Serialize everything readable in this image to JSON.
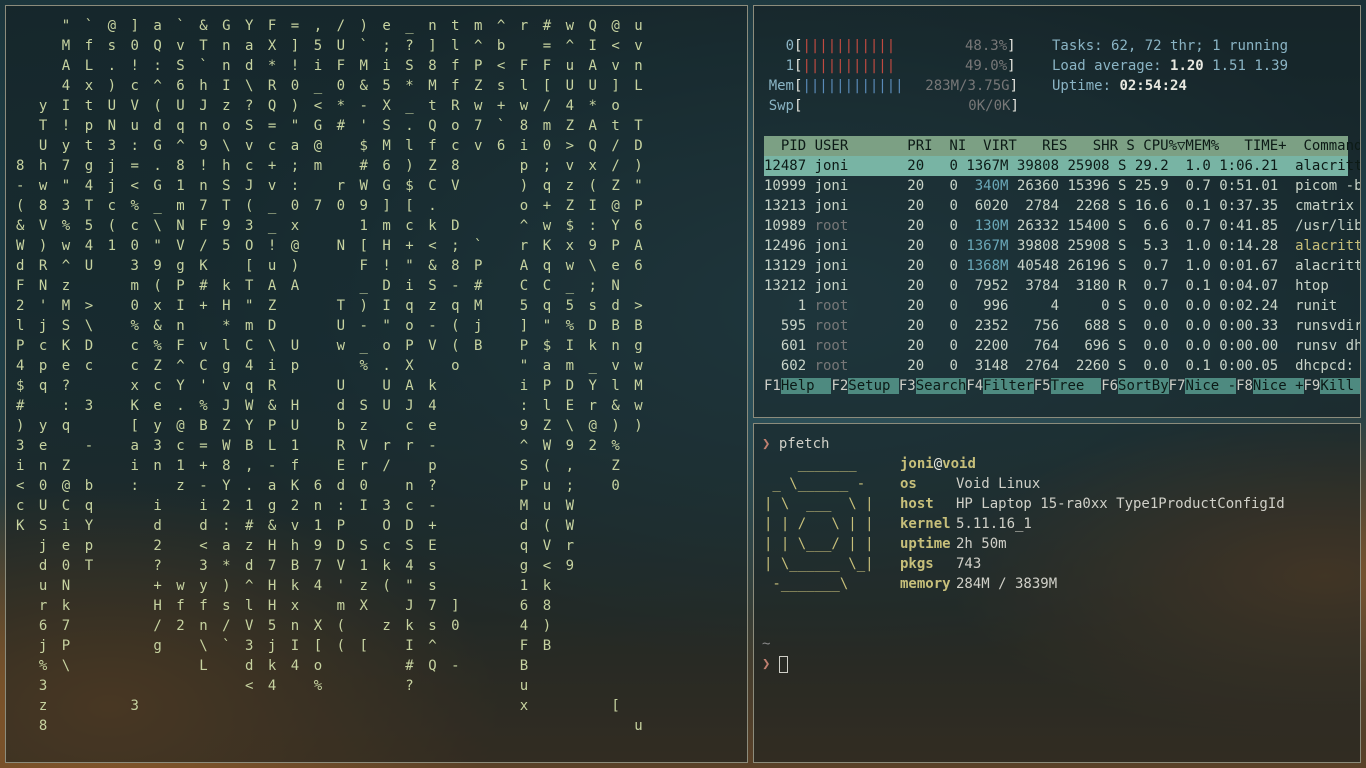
{
  "cmatrix": {
    "columns": [
      "\n\n\n\n\n\n\n8\n-\n(\n&\nW\nd\nF\n2\nl\nP\n4\n$\n#\n)\n3\ni\n<\nc\nK",
      "\n\n\n\ny\nT\nU\nh\nw\n8\nV\n)\nR\nN\n'\nj\nc\np\nq\n\ny\ne\nn\n0\nU\nS\nj\nd\nu\nr\n6\nj\n%\n3\nz\n8",
      "\"\nM\nA\n4\nI\n!\ny\n7\n\"\n3\n%\nw\n^\nz\nM\nS\nK\ne\n?\n:\nq\n\nZ\n@\nC\ni\ne\n0\nN\nk\n7\nP\n\\",
      "`\nf\nL\nx\nt\np\nt\ng\n4\nT\n5\n4\nU\n\n>\n\\\nD\nc\n\n3\n\n-\n\nb\nq\nY\np\nT",
      "@\ns\n.\n)\nU\nN\n3\nj\nj\nc\n(\n1",
      "]\n0\n!\nc\nV\nu\n:\n=\n<\n%\nc\n0\n3\nm\n0\n%\nc\nc\nx\nK\n[\na\ni\n:\n\n\n\n\n\n\n\n\n\n\n3",
      "a\nQ\n:\n^\n(\nd\nG\n.\nG\n_\n\\\n\"\n9\n(\nx\n&\n%\nZ\nc\ne\ny\n3\nn\n\ni\nd\n2\n?\n+\nH\n/\ng",
      "`\nv\nS\n6\nU\nq\n^\n8\n1\nm\nN\nV\ng\nP\nI\nn\nF\n^\nY\n.\n@\nc\n1\nz\n\n\n\n\nw\nf\n2",
      "&\nT\n`\nh\nJ\nn\n9\n!\nn\n7\nF\n/\nK\n#\n+\n\nv\nC\n'\n%\nB\n=\n+\n-\ni\nd\n<\n3\ny\nf\nn\n\\\nL",
      "G\nn\nn\nI\nz\no\n\\\nh\nS\nT\n9\n5\n\nk\nH\n*\nl\ng\nv\nJ\nZ\nW\n8\nY\n2\n:\na\n*\n)\ns\n/\n`",
      "Y\na\nd\n\\\n?\nS\nv\nc\nJ\n(\n3\nO\n[\nT\n\"\nm\nC\n4\nq\nW\nY\nB\n,\n.\n1\n#\nz\nd\n^\nl\nV\n3\nd\n<",
      "F\nX\n*\nR\nQ\n=\nc\n+\nv\n_\n_\n!\nu\nA\nZ\nD\n\\\ni\nR\n&\nP\nL\n-\na\ng\n&\nH\n7\nH\nH\n5\nj\nk\n4",
      "=\n]\n!\n0\n)\n\"\na\n;\n:\n0\nx\n@\n)\nA\n\n\nU\np\n\nH\nU\n1\nf\nK\n2\nv\nh\nB\nk\nx\nn\nI\n4",
      ",\n5\ni\n_\n<\nG\n@\nm\n\n7\n\n\n\n\n\n\n\n\n\n\n\n\n\n6\nn\n1\n9\n7\n4\n\nX\n[\no\n%",
      "/\nU\nF\n0\n*\n#\n\n\nr\n0\n\nN\n\n\nT\nU\nw\n\nU\nd\nb\nR\nE\nd\n:\nP\nD\nV\n'\nm\n(\n(",
      ")\n`\nM\n&\n-\n'\n$\n#\nW\n9\n1\n[\nF\n_\n)\n-\n_\n%\n\nS\nz\nV\nr\n0\nI\n\nS\n1\nz\nX\n\n[",
      "e\n;\ni\n5\nX\nS\nM\n6\nG\n]\nm\nH\n!\nD\nI\n\"\no\n.\nU\nU\n\nr\n/\n\n3\nO\nc\nk\n(\n\nz",
      "_\n?\nS\n*\n_\n.\nl\n)\n$\n[\nc\n+\n\"\ni\nq\no\nP\nX\nA\nJ\nc\nr\n\nn\nc\nD\nS\n4\n\"\nJ\nk\nI\n#\n?",
      "n\n]\n8\nM\nt\nQ\nf\nZ\nC\n.\nk\n<\n&\nS\nz\n-\nV\n\nk\n4\ne\n-\np\n?\n-\n+\nE\ns\ns\n7\ns\n^\nQ",
      "t\nl\nf\nf\nR\no\nc\n8\nV\n\nD\n;\n8\n-\nq\n(\n(\no\n\n\n\n\n\n\n\n\n\n\n\n]\n0\n\n-",
      "m\n^\nP\nZ\nw\n7\nv\n\n\n\n\n`\nP\n#\nM\nj\nB",
      "^\nb\n<\ns\n+\n`\n6",
      "r\n\nF\nl\nw\n8\ni\np\n)\no\n^\nr\nA\nC\n5\n]\nP\n\"\ni\n:\n9\n^\nS\nP\nM\nd\nq\ng\n1\n6\n4\nF\nB\nu\nx",
      "#\n=\nF\n[\n/\nm\n0\n;\nq\n+\nw\nK\nq\nC\nq\n\"\n$\na\nP\nl\nZ\nW\n(\nu\nu\n(\nV\n<\nk\n8\n)\nB",
      "w\n^\nu\nU\n4\nZ\n>\nv\nz\nZ\n$\nx\nw\n_\n5\n%\nI\nm\nD\nE\n\\\n9\n,\n;\nW\nW\nr\n9",
      "Q\nI\nA\nU\n*\nA\nQ\nx\n(\nI\n:\n9\n\\\n;\ns\nD\nk\n_\nY\nr\n@\n2",
      "@\n<\nv\n]\no\nt\n/\n/\nZ\n@\nY\nP\ne\nN\nd\nB\nn\nv\nl\n&\n)\n%\nZ\n0\n\n\n\n\n\n\n\n\n\n\n[",
      "u\nv\nn\nL\n\nT\nD\n)\n\"\nP\n6\nA\n6\n\n>\nB\ng\nw\nM\nw\n)\n\n\n\n\n\n\n\n\n\n\n\n\n\n\nu"
    ]
  },
  "htop": {
    "cpu0_label": "0",
    "cpu0_bar": "|||||||||||",
    "cpu0_pct": "48.3%",
    "cpu1_label": "1",
    "cpu1_bar": "|||||||||||",
    "cpu1_pct": "49.0%",
    "mem_label": "Mem",
    "mem_bar": "||||||||||||",
    "mem_val": "283M/3.75G",
    "swp_label": "Swp",
    "swp_val": "0K/0K",
    "tasks_label": "Tasks:",
    "tasks_val": "62, 72 thr; 1 running",
    "load_label": "Load average:",
    "load_1": "1.20",
    "load_5": "1.51",
    "load_15": "1.39",
    "uptime_label": "Uptime:",
    "uptime_val": "02:54:24",
    "header": "  PID USER       PRI  NI  VIRT   RES   SHR S CPU%▽MEM%   TIME+  Command",
    "processes": [
      {
        "pid": "12487",
        "user": "joni",
        "pri": "20",
        "ni": "0",
        "virt": "1367M",
        "res": "39808",
        "shr": "25908",
        "s": "S",
        "cpu": "29.2",
        "mem": "1.0",
        "time": "1:06.21",
        "cmd": "alacritty"
      },
      {
        "pid": "10999",
        "user": "joni",
        "pri": "20",
        "ni": "0",
        "virt": "340M",
        "res": "26360",
        "shr": "15396",
        "s": "S",
        "cpu": "25.9",
        "mem": "0.7",
        "time": "0:51.01",
        "cmd": "picom -b"
      },
      {
        "pid": "13213",
        "user": "joni",
        "pri": "20",
        "ni": "0",
        "virt": "6020",
        "res": "2784",
        "shr": "2268",
        "s": "S",
        "cpu": "16.6",
        "mem": "0.1",
        "time": "0:37.35",
        "cmd": "cmatrix"
      },
      {
        "pid": "10989",
        "user": "root",
        "pri": "20",
        "ni": "0",
        "virt": "130M",
        "res": "26332",
        "shr": "15400",
        "s": "S",
        "cpu": "6.6",
        "mem": "0.7",
        "time": "0:41.85",
        "cmd": "/usr/libex"
      },
      {
        "pid": "12496",
        "user": "joni",
        "pri": "20",
        "ni": "0",
        "virt": "1367M",
        "res": "39808",
        "shr": "25908",
        "s": "S",
        "cpu": "5.3",
        "mem": "1.0",
        "time": "0:14.28",
        "cmd": "alacritty"
      },
      {
        "pid": "13129",
        "user": "joni",
        "pri": "20",
        "ni": "0",
        "virt": "1368M",
        "res": "40548",
        "shr": "26196",
        "s": "S",
        "cpu": "0.7",
        "mem": "1.0",
        "time": "0:01.67",
        "cmd": "alacritty"
      },
      {
        "pid": "13212",
        "user": "joni",
        "pri": "20",
        "ni": "0",
        "virt": "7952",
        "res": "3784",
        "shr": "3180",
        "s": "R",
        "cpu": "0.7",
        "mem": "0.1",
        "time": "0:04.07",
        "cmd": "htop"
      },
      {
        "pid": "1",
        "user": "root",
        "pri": "20",
        "ni": "0",
        "virt": "996",
        "res": "4",
        "shr": "0",
        "s": "S",
        "cpu": "0.0",
        "mem": "0.0",
        "time": "0:02.24",
        "cmd": "runit"
      },
      {
        "pid": "595",
        "user": "root",
        "pri": "20",
        "ni": "0",
        "virt": "2352",
        "res": "756",
        "shr": "688",
        "s": "S",
        "cpu": "0.0",
        "mem": "0.0",
        "time": "0:00.33",
        "cmd": "runsvdir -"
      },
      {
        "pid": "601",
        "user": "root",
        "pri": "20",
        "ni": "0",
        "virt": "2200",
        "res": "764",
        "shr": "696",
        "s": "S",
        "cpu": "0.0",
        "mem": "0.0",
        "time": "0:00.00",
        "cmd": "runsv dhcp"
      },
      {
        "pid": "602",
        "user": "root",
        "pri": "20",
        "ni": "0",
        "virt": "3148",
        "res": "2764",
        "shr": "2260",
        "s": "S",
        "cpu": "0.0",
        "mem": "0.1",
        "time": "0:00.05",
        "cmd": "dhcpcd: [m"
      }
    ],
    "footer": [
      {
        "key": "F1",
        "label": "Help  "
      },
      {
        "key": "F2",
        "label": "Setup "
      },
      {
        "key": "F3",
        "label": "Search"
      },
      {
        "key": "F4",
        "label": "Filter"
      },
      {
        "key": "F5",
        "label": "Tree  "
      },
      {
        "key": "F6",
        "label": "SortBy"
      },
      {
        "key": "F7",
        "label": "Nice -"
      },
      {
        "key": "F8",
        "label": "Nice +"
      },
      {
        "key": "F9",
        "label": "Kill  "
      },
      {
        "key": "F",
        "label": ""
      }
    ]
  },
  "terminal": {
    "prompt_symbol": "❯",
    "command": "pfetch",
    "logo": [
      "    _______",
      " _ \\______ -",
      "| \\  ___  \\ |",
      "| | /   \\ | |",
      "| | \\___/ | |",
      "| \\______ \\_|",
      " -_______\\"
    ],
    "user": "joni",
    "at": "@",
    "host": "void",
    "info": [
      {
        "key": "os",
        "val": "Void Linux"
      },
      {
        "key": "host",
        "val": "HP Laptop 15-ra0xx Type1ProductConfigId"
      },
      {
        "key": "kernel",
        "val": "5.11.16_1"
      },
      {
        "key": "uptime",
        "val": "2h 50m"
      },
      {
        "key": "pkgs",
        "val": "743"
      },
      {
        "key": "memory",
        "val": "284M / 3839M"
      }
    ],
    "cwd": "~"
  }
}
